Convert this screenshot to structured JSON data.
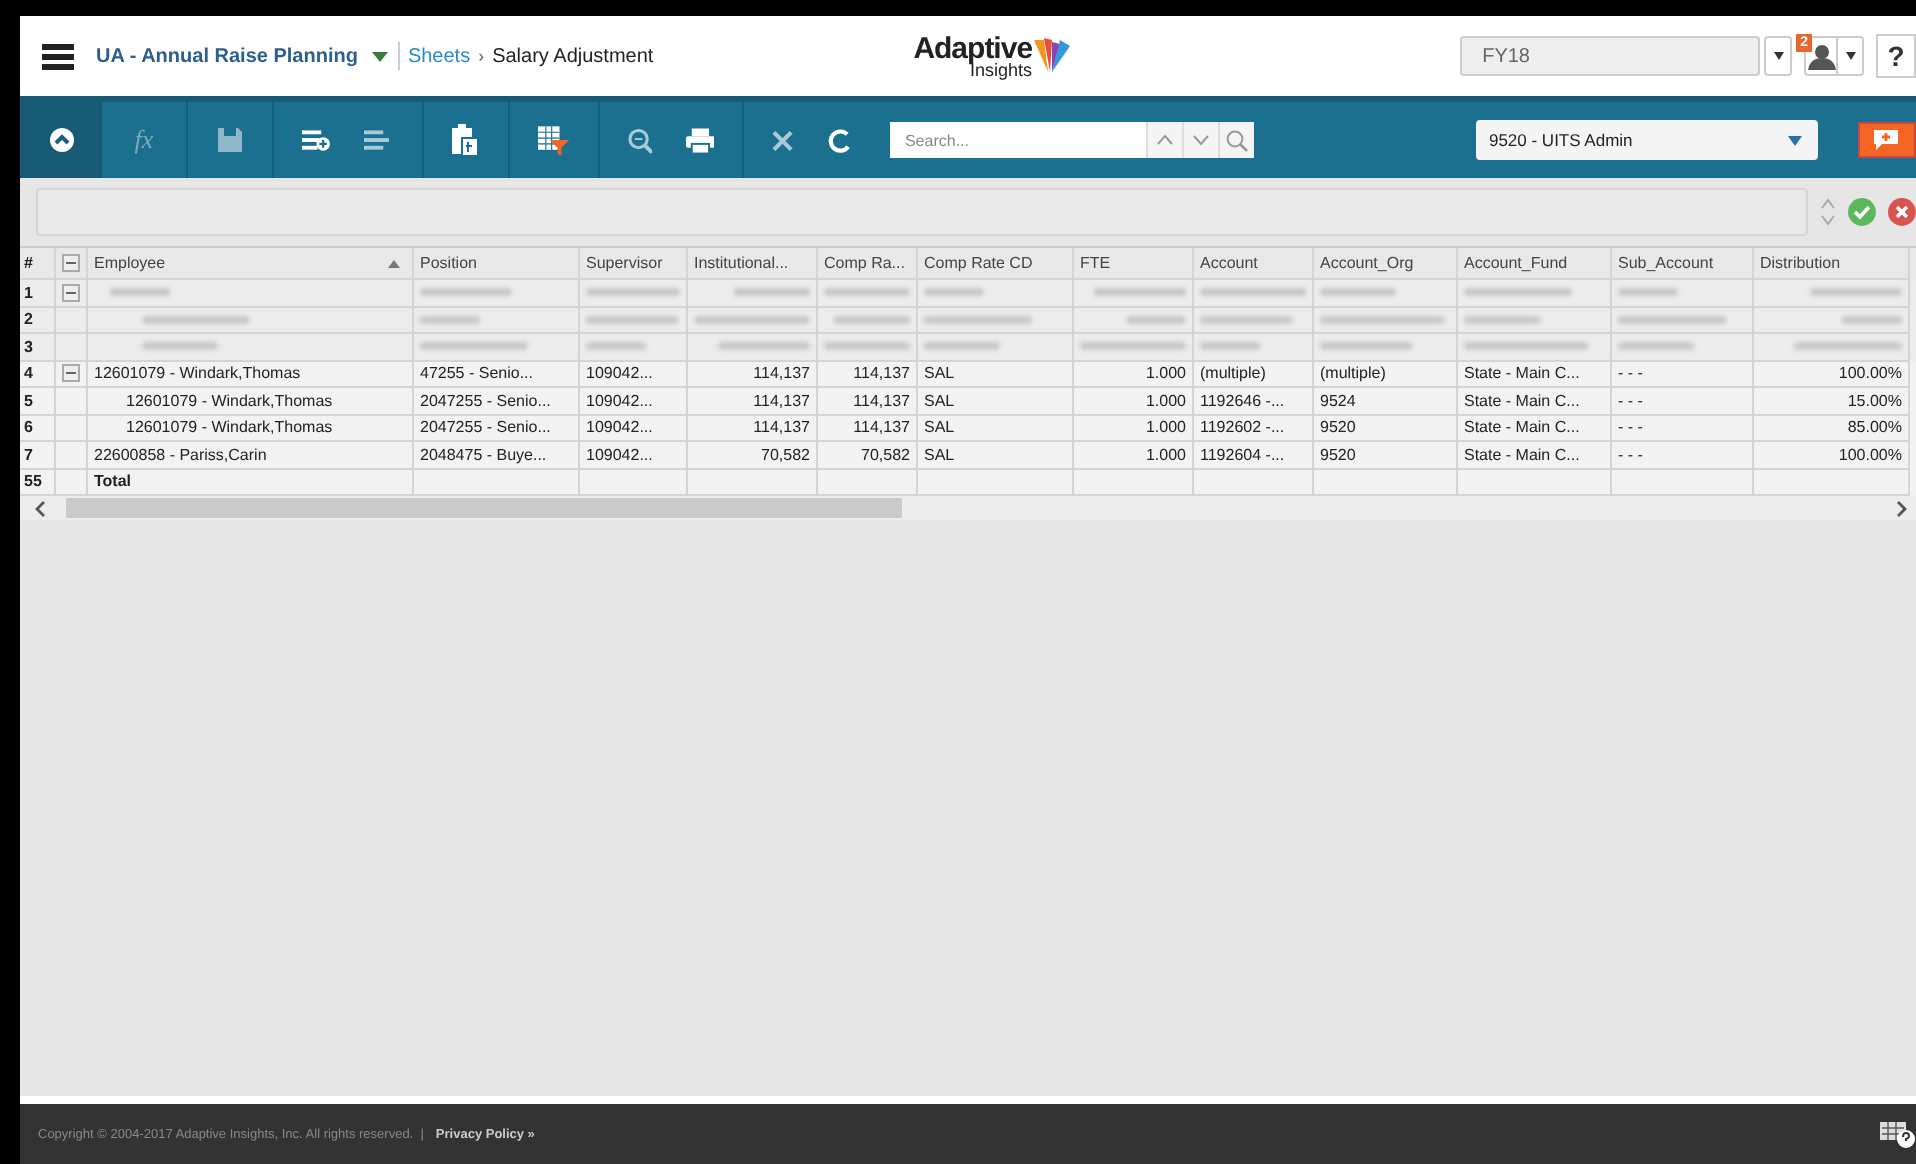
{
  "header": {
    "app_menu": "UA - Annual Raise Planning",
    "breadcrumb_link": "Sheets",
    "breadcrumb_separator": "›",
    "page_title": "Salary Adjustment",
    "logo_word": "Adaptive",
    "logo_sub": "Insights",
    "version_select": "FY18",
    "notification_count": "2",
    "help": "?"
  },
  "toolbar": {
    "formula_label": "fx",
    "search": {
      "placeholder": "Search..."
    },
    "level_select": "9520 - UITS Admin"
  },
  "grid": {
    "number_header": "#",
    "columns": [
      {
        "label": "Employee",
        "sorted": true,
        "numeric": false
      },
      {
        "label": "Position",
        "sorted": false,
        "numeric": false
      },
      {
        "label": "Supervisor",
        "sorted": false,
        "numeric": false
      },
      {
        "label": "Institutional...",
        "sorted": false,
        "numeric": true
      },
      {
        "label": "Comp Ra...",
        "sorted": false,
        "numeric": true
      },
      {
        "label": "Comp Rate CD",
        "sorted": false,
        "numeric": false
      },
      {
        "label": "FTE",
        "sorted": false,
        "numeric": true
      },
      {
        "label": "Account",
        "sorted": false,
        "numeric": false
      },
      {
        "label": "Account_Org",
        "sorted": false,
        "numeric": false
      },
      {
        "label": "Account_Fund",
        "sorted": false,
        "numeric": false
      },
      {
        "label": "Sub_Account",
        "sorted": false,
        "numeric": false
      },
      {
        "label": "Distribution",
        "sorted": false,
        "numeric": true
      }
    ],
    "rows": [
      {
        "number": "1",
        "expanded": true,
        "blurred": true,
        "children": [
          {
            "number": "2",
            "blurred": true
          },
          {
            "number": "3",
            "blurred": true
          }
        ]
      },
      {
        "number": "4",
        "expanded": true,
        "blurred": false,
        "cells": [
          "12601079 - Windark,Thomas",
          "47255 - Senio...",
          "109042...",
          "114,137",
          "114,137",
          "SAL",
          "1.000",
          "(multiple)",
          "(multiple)",
          "State - Main C...",
          "- - -",
          "100.00%"
        ],
        "children": [
          {
            "number": "5",
            "blurred": false,
            "cells": [
              "12601079 - Windark,Thomas",
              "2047255 - Senio...",
              "109042...",
              "114,137",
              "114,137",
              "SAL",
              "1.000",
              "1192646 -...",
              "9524",
              "State - Main C...",
              "- - -",
              "15.00%"
            ]
          },
          {
            "number": "6",
            "blurred": false,
            "cells": [
              "12601079 - Windark,Thomas",
              "2047255 - Senio...",
              "109042...",
              "114,137",
              "114,137",
              "SAL",
              "1.000",
              "1192602 -...",
              "9520",
              "State - Main C...",
              "- - -",
              "85.00%"
            ]
          }
        ]
      },
      {
        "number": "7",
        "blurred": false,
        "cells": [
          "22600858 - Pariss,Carin",
          "2048475 - Buye...",
          "109042...",
          "70,582",
          "70,582",
          "SAL",
          "1.000",
          "1192604 -...",
          "9520",
          "State - Main C...",
          "- - -",
          "100.00%"
        ]
      }
    ],
    "total": {
      "number": "55",
      "label": "Total"
    }
  },
  "footer": {
    "copyright": "Copyright © 2004-2017 Adaptive Insights, Inc. All rights reserved.  |",
    "privacy_link": "Privacy Policy »"
  }
}
